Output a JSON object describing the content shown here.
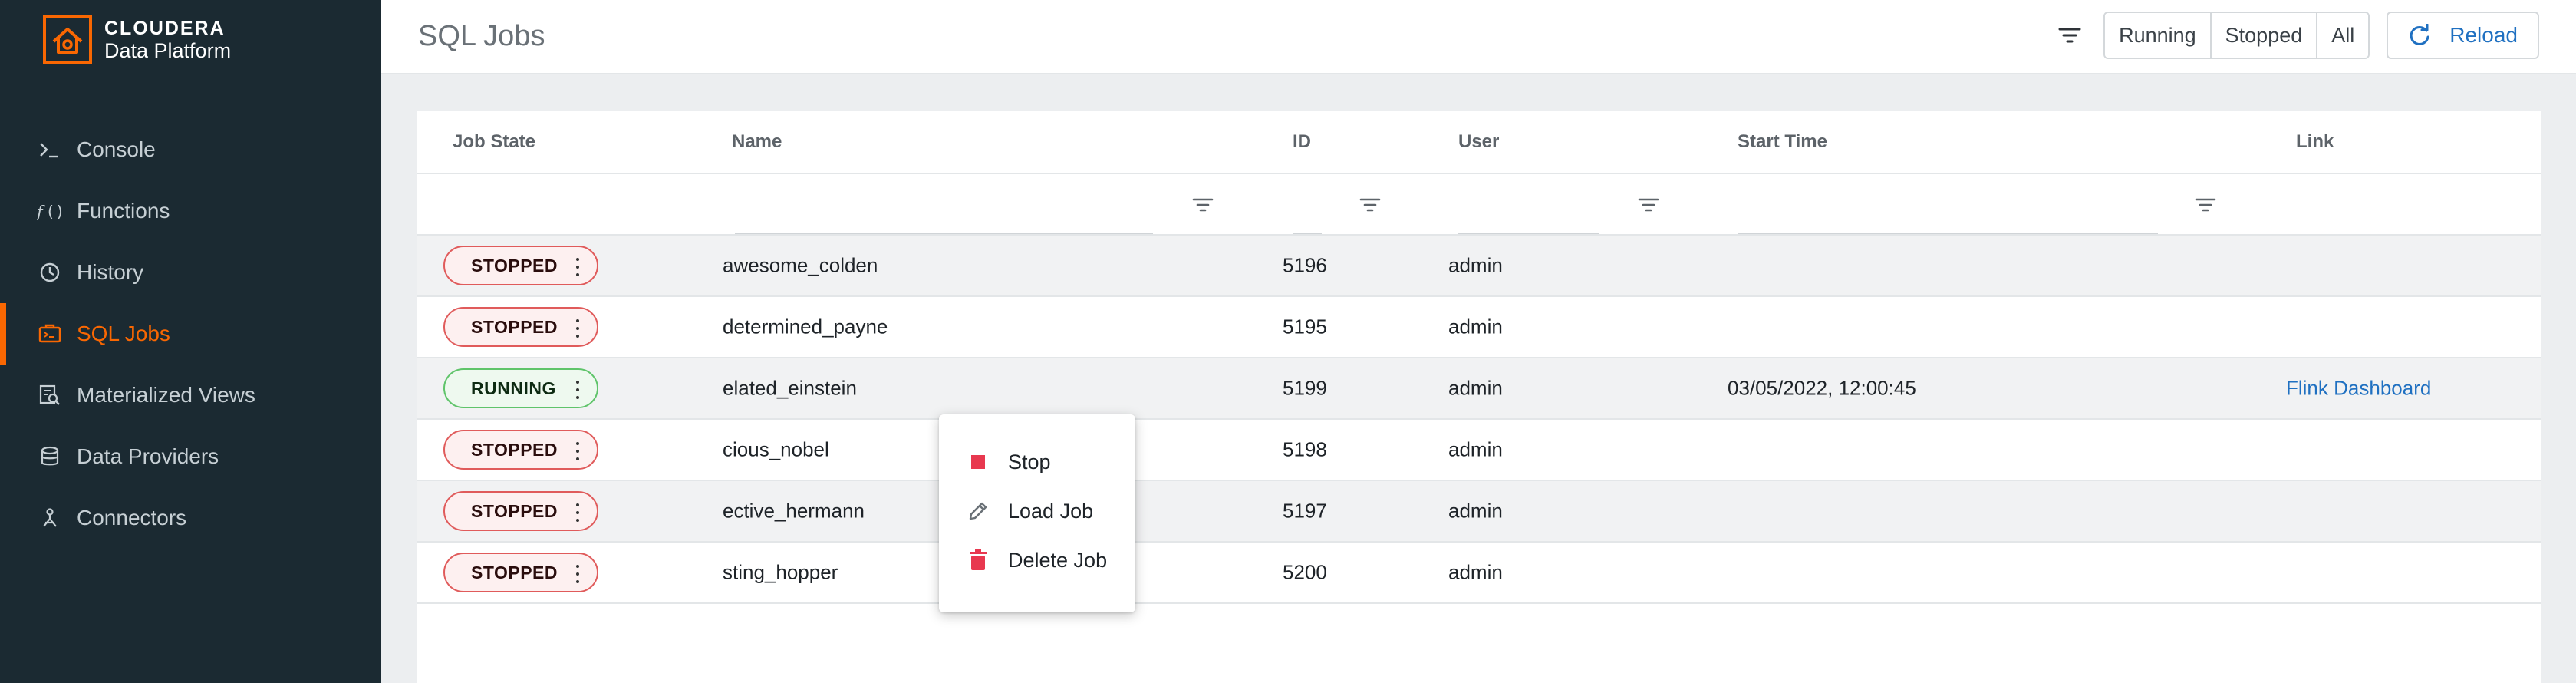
{
  "brand": {
    "name": "CLOUDERA",
    "product": "Data Platform",
    "accent": "#f96702"
  },
  "sidebar": {
    "items": [
      {
        "label": "Console",
        "icon": "terminal-icon",
        "active": false
      },
      {
        "label": "Functions",
        "icon": "function-icon",
        "active": false
      },
      {
        "label": "History",
        "icon": "history-icon",
        "active": false
      },
      {
        "label": "SQL Jobs",
        "icon": "sql-jobs-icon",
        "active": true
      },
      {
        "label": "Materialized Views",
        "icon": "materialized-views-icon",
        "active": false
      },
      {
        "label": "Data Providers",
        "icon": "data-providers-icon",
        "active": false
      },
      {
        "label": "Connectors",
        "icon": "connectors-icon",
        "active": false
      }
    ]
  },
  "header": {
    "title": "SQL Jobs",
    "filters": [
      "Running",
      "Stopped",
      "All"
    ],
    "reload_label": "Reload"
  },
  "table": {
    "columns": [
      "Job State",
      "Name",
      "ID",
      "User",
      "Start Time",
      "Link"
    ],
    "rows": [
      {
        "state": "STOPPED",
        "name": "awesome_colden",
        "id": "5196",
        "user": "admin",
        "start": "",
        "link": ""
      },
      {
        "state": "STOPPED",
        "name": "determined_payne",
        "id": "5195",
        "user": "admin",
        "start": "",
        "link": ""
      },
      {
        "state": "RUNNING",
        "name": "elated_einstein",
        "id": "5199",
        "user": "admin",
        "start": "03/05/2022, 12:00:45",
        "link": "Flink Dashboard"
      },
      {
        "state": "STOPPED",
        "name": "cious_nobel",
        "id": "5198",
        "user": "admin",
        "start": "",
        "link": ""
      },
      {
        "state": "STOPPED",
        "name": "ective_hermann",
        "id": "5197",
        "user": "admin",
        "start": "",
        "link": ""
      },
      {
        "state": "STOPPED",
        "name": "sting_hopper",
        "id": "5200",
        "user": "admin",
        "start": "",
        "link": ""
      }
    ]
  },
  "context_menu": {
    "items": [
      {
        "label": "Stop",
        "icon": "stop-icon"
      },
      {
        "label": "Load Job",
        "icon": "pencil-icon"
      },
      {
        "label": "Delete Job",
        "icon": "trash-icon"
      }
    ]
  },
  "colors": {
    "sidebar_bg": "#1b2a32",
    "stopped_border": "#e05b5b",
    "running_border": "#5fc46a",
    "link": "#1f70c1",
    "danger": "#e8384f"
  }
}
